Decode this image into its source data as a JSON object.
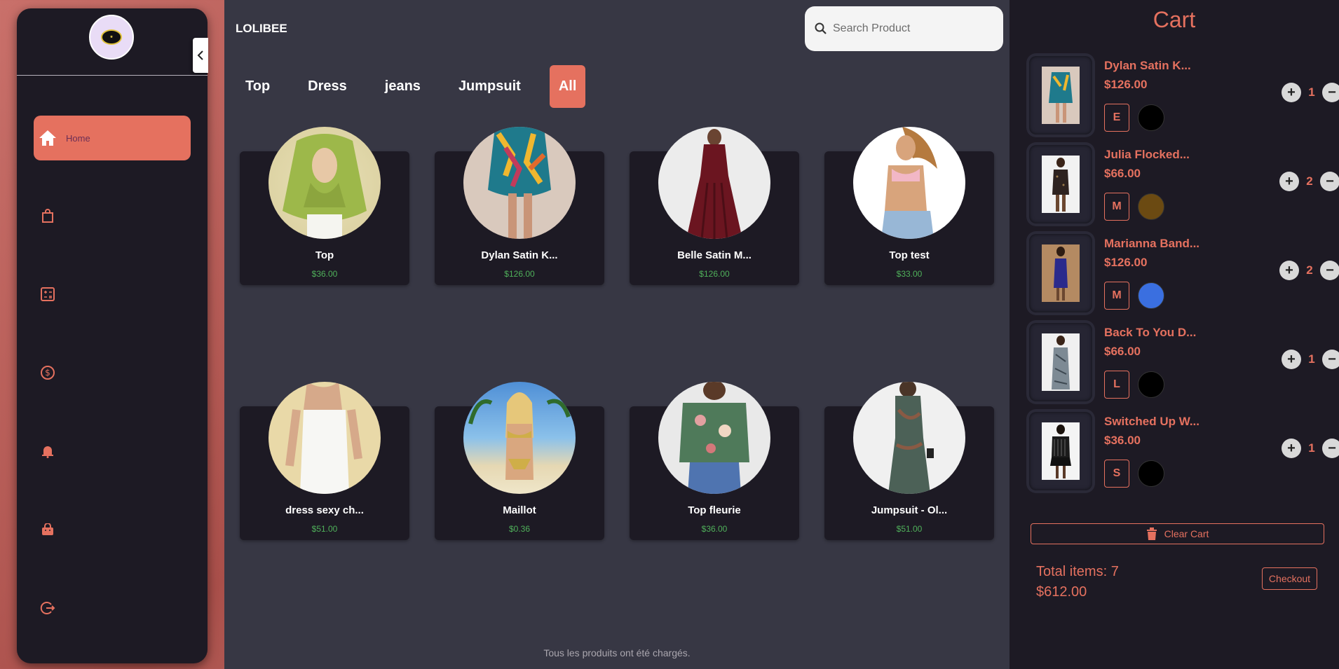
{
  "brand": "LOLIBEE",
  "search": {
    "placeholder": "Search Product"
  },
  "sidebar": {
    "home_label": "Home",
    "icons": [
      "home-icon",
      "bag-icon",
      "calculator-icon",
      "dollar-icon",
      "bell-icon",
      "shopping-bag-icon",
      "logout-icon"
    ]
  },
  "tabs": [
    "Top",
    "Dress",
    "jeans",
    "Jumpsuit",
    "All"
  ],
  "active_tab": "All",
  "products": [
    {
      "name": "Top",
      "price": "$36.00"
    },
    {
      "name": "Dylan Satin K...",
      "price": "$126.00"
    },
    {
      "name": "Belle Satin M...",
      "price": "$126.00"
    },
    {
      "name": "Top test",
      "price": "$33.00"
    },
    {
      "name": "dress sexy ch...",
      "price": "$51.00"
    },
    {
      "name": "Maillot",
      "price": "$0.36"
    },
    {
      "name": "Top fleurie",
      "price": "$36.00"
    },
    {
      "name": "Jumpsuit - Ol...",
      "price": "$51.00"
    }
  ],
  "footer_note": "Tous les produits ont été chargés.",
  "cart": {
    "title": "Cart",
    "items": [
      {
        "name": "Dylan Satin K...",
        "price": "$126.00",
        "size": "E",
        "color": "#000000",
        "qty": "1"
      },
      {
        "name": "Julia Flocked...",
        "price": "$66.00",
        "size": "M",
        "color": "#6b4a12",
        "qty": "2"
      },
      {
        "name": "Marianna Band...",
        "price": "$126.00",
        "size": "M",
        "color": "#3a6fe0",
        "qty": "2"
      },
      {
        "name": "Back To You D...",
        "price": "$66.00",
        "size": "L",
        "color": "#000000",
        "qty": "1"
      },
      {
        "name": "Switched Up W...",
        "price": "$36.00",
        "size": "S",
        "color": "#000000",
        "qty": "1"
      }
    ],
    "clear_label": "Clear Cart",
    "total_items_label": "Total items: 7",
    "total_price": "$612.00",
    "checkout_label": "Checkout"
  },
  "colors": {
    "accent": "#e5715f",
    "panel": "#1d1a24",
    "main_bg": "#373744",
    "price_green": "#4fb05a"
  }
}
